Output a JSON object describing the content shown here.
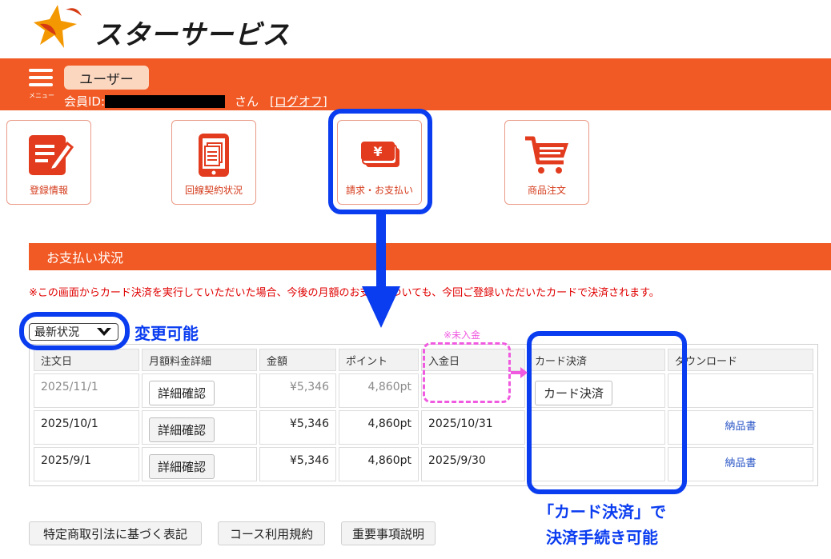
{
  "brand": {
    "name": "スターサービス"
  },
  "header": {
    "menu_caption": "メニュー",
    "user_tab": "ユーザー",
    "member_label": "会員ID:",
    "member_suffix": "さん",
    "logoff": "[ログオフ]"
  },
  "tiles": [
    {
      "label": "登録情報",
      "icon": "registration-form-icon"
    },
    {
      "label": "回線契約状況",
      "icon": "contract-document-icon"
    },
    {
      "label": "請求・お支払い",
      "icon": "billing-yen-icon"
    },
    {
      "label": "商品注文",
      "icon": "shopping-cart-icon"
    }
  ],
  "section": {
    "title": "お支払い状況",
    "notice": "※この画面からカード決済を実行していただいた場合、今後の月額のお支払についても、今回ご登録いただいたカードで決済されます。"
  },
  "filter": {
    "selected": "最新状況"
  },
  "table": {
    "headers": [
      "注文日",
      "月額料金詳細",
      "金額",
      "ポイント",
      "入金日",
      "カード決済",
      "ダウンロード"
    ],
    "detail_button": "詳細確認",
    "card_button": "カード決済",
    "download_label": "納品書",
    "rows": [
      {
        "order_date": "2025/11/1",
        "amount": "¥5,346",
        "points": "4,860pt",
        "paid_date": "",
        "card": true,
        "download": ""
      },
      {
        "order_date": "2025/10/1",
        "amount": "¥5,346",
        "points": "4,860pt",
        "paid_date": "2025/10/31",
        "card": false,
        "download": "納品書"
      },
      {
        "order_date": "2025/9/1",
        "amount": "¥5,346",
        "points": "4,860pt",
        "paid_date": "2025/9/30",
        "card": false,
        "download": "納品書"
      }
    ]
  },
  "footer": {
    "buttons": [
      "特定商取引法に基づく表記",
      "コース利用規約",
      "重要事項説明"
    ]
  },
  "annotations": {
    "change_possible": "変更可能",
    "unpaid": "※未入金",
    "card_note_line1": "「カード決済」で",
    "card_note_line2": "決済手続き可能"
  },
  "colors": {
    "brand_orange": "#f15a24",
    "annotation_blue": "#0a3cf0",
    "annotation_pink": "#f05ae0",
    "link_blue": "#2a56c6",
    "notice_red": "#e00000"
  }
}
